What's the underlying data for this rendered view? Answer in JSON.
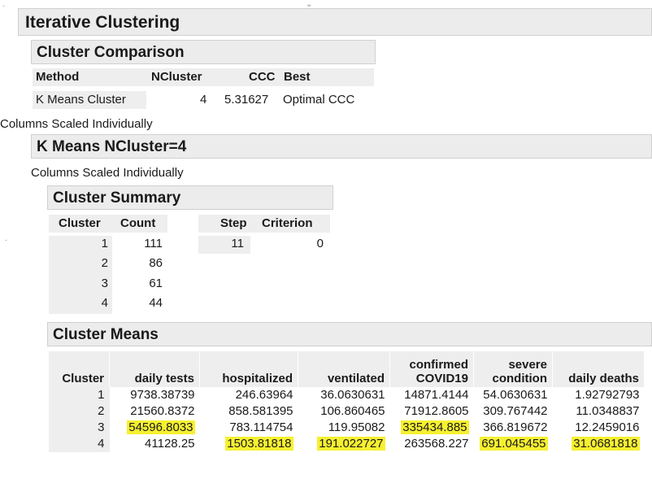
{
  "report": {
    "title": "Iterative Clustering",
    "comparison": {
      "title": "Cluster Comparison",
      "headers": [
        "Method",
        "NCluster",
        "CCC",
        "Best"
      ],
      "row": [
        "K Means Cluster",
        "4",
        "5.31627",
        "Optimal CCC"
      ]
    },
    "scaling_note_1": "Columns Scaled Individually",
    "kmeans": {
      "title": "K Means NCluster=4",
      "scaling_note_2": "Columns Scaled Individually",
      "summary": {
        "title": "Cluster Summary",
        "headers": [
          "Cluster",
          "Count"
        ],
        "rows": [
          [
            "1",
            "111"
          ],
          [
            "2",
            "86"
          ],
          [
            "3",
            "61"
          ],
          [
            "4",
            "44"
          ]
        ],
        "step_headers": [
          "Step",
          "Criterion"
        ],
        "step_row": [
          "11",
          "0"
        ]
      },
      "means": {
        "title": "Cluster Means",
        "headers": [
          "Cluster",
          "daily tests",
          "hospitalized",
          "ventilated",
          "confirmed COVID19",
          "severe condition",
          "daily deaths"
        ],
        "rows": [
          [
            "1",
            "9738.38739",
            "246.63964",
            "36.0630631",
            "14871.4144",
            "54.0630631",
            "1.92792793"
          ],
          [
            "2",
            "21560.8372",
            "858.581395",
            "106.860465",
            "71912.8605",
            "309.767442",
            "11.0348837"
          ],
          [
            "3",
            "54596.8033",
            "783.114754",
            "119.95082",
            "335434.885",
            "366.819672",
            "12.2459016"
          ],
          [
            "4",
            "41128.25",
            "1503.81818",
            "191.022727",
            "263568.227",
            "691.045455",
            "31.0681818"
          ]
        ],
        "highlight_color": "#f6f030"
      }
    }
  }
}
